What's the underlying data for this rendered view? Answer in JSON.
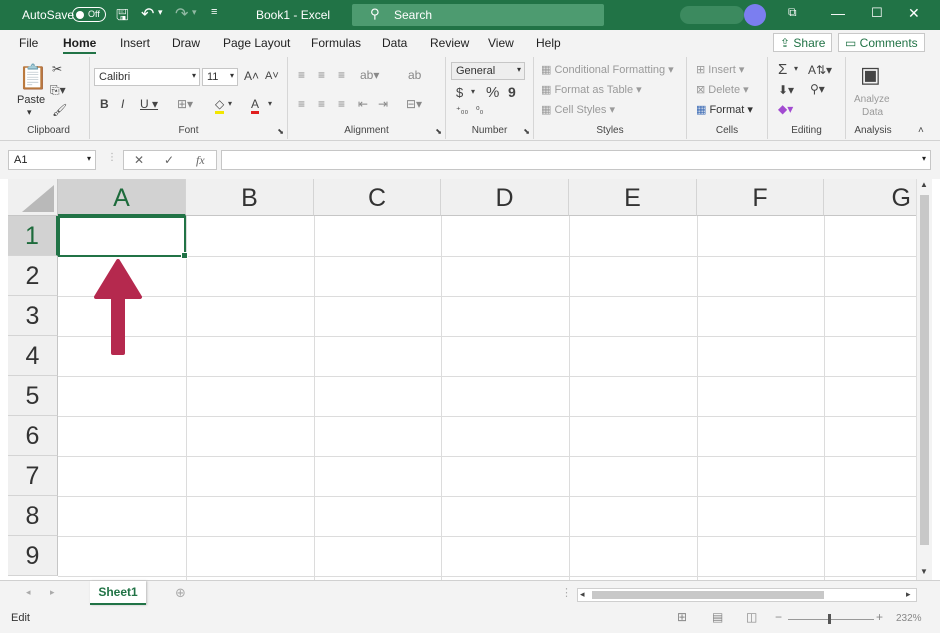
{
  "titlebar": {
    "autosave_label": "AutoSave",
    "autosave_state": "Off",
    "document_title": "Book1  -  Excel",
    "search_placeholder": "Search",
    "accent_color": "#217346"
  },
  "menu": {
    "tabs": [
      "File",
      "Home",
      "Insert",
      "Draw",
      "Page Layout",
      "Formulas",
      "Data",
      "Review",
      "View",
      "Help"
    ],
    "active_tab": "Home",
    "share_label": "Share",
    "comments_label": "Comments"
  },
  "ribbon": {
    "clipboard": {
      "paste_label": "Paste",
      "group_label": "Clipboard"
    },
    "font": {
      "font_name": "Calibri",
      "font_size": "11",
      "group_label": "Font"
    },
    "alignment": {
      "group_label": "Alignment"
    },
    "number": {
      "format": "General",
      "currency_symbol": "$",
      "percent_symbol": "%",
      "comma_symbol": "9",
      "group_label": "Number"
    },
    "styles": {
      "conditional_formatting": "Conditional Formatting",
      "format_as_table": "Format as Table",
      "cell_styles": "Cell Styles",
      "group_label": "Styles"
    },
    "cells": {
      "insert": "Insert",
      "delete": "Delete",
      "format": "Format",
      "group_label": "Cells"
    },
    "editing": {
      "sum_symbol": "Σ",
      "group_label": "Editing"
    },
    "analysis": {
      "analyze_line1": "Analyze",
      "analyze_line2": "Data",
      "group_label": "Analysis"
    }
  },
  "formula_bar": {
    "name_box": "A1",
    "fx_label": "fx",
    "formula": ""
  },
  "grid": {
    "columns": [
      "A",
      "B",
      "C",
      "D",
      "E",
      "F",
      "G"
    ],
    "rows": [
      "1",
      "2",
      "3",
      "4",
      "5",
      "6",
      "7",
      "8",
      "9"
    ],
    "active_column": "A",
    "active_row": "1",
    "annotation_arrow_color": "#b5294e"
  },
  "sheets": {
    "tabs": [
      "Sheet1"
    ],
    "active": "Sheet1"
  },
  "status": {
    "mode": "Edit",
    "zoom": "232%"
  }
}
